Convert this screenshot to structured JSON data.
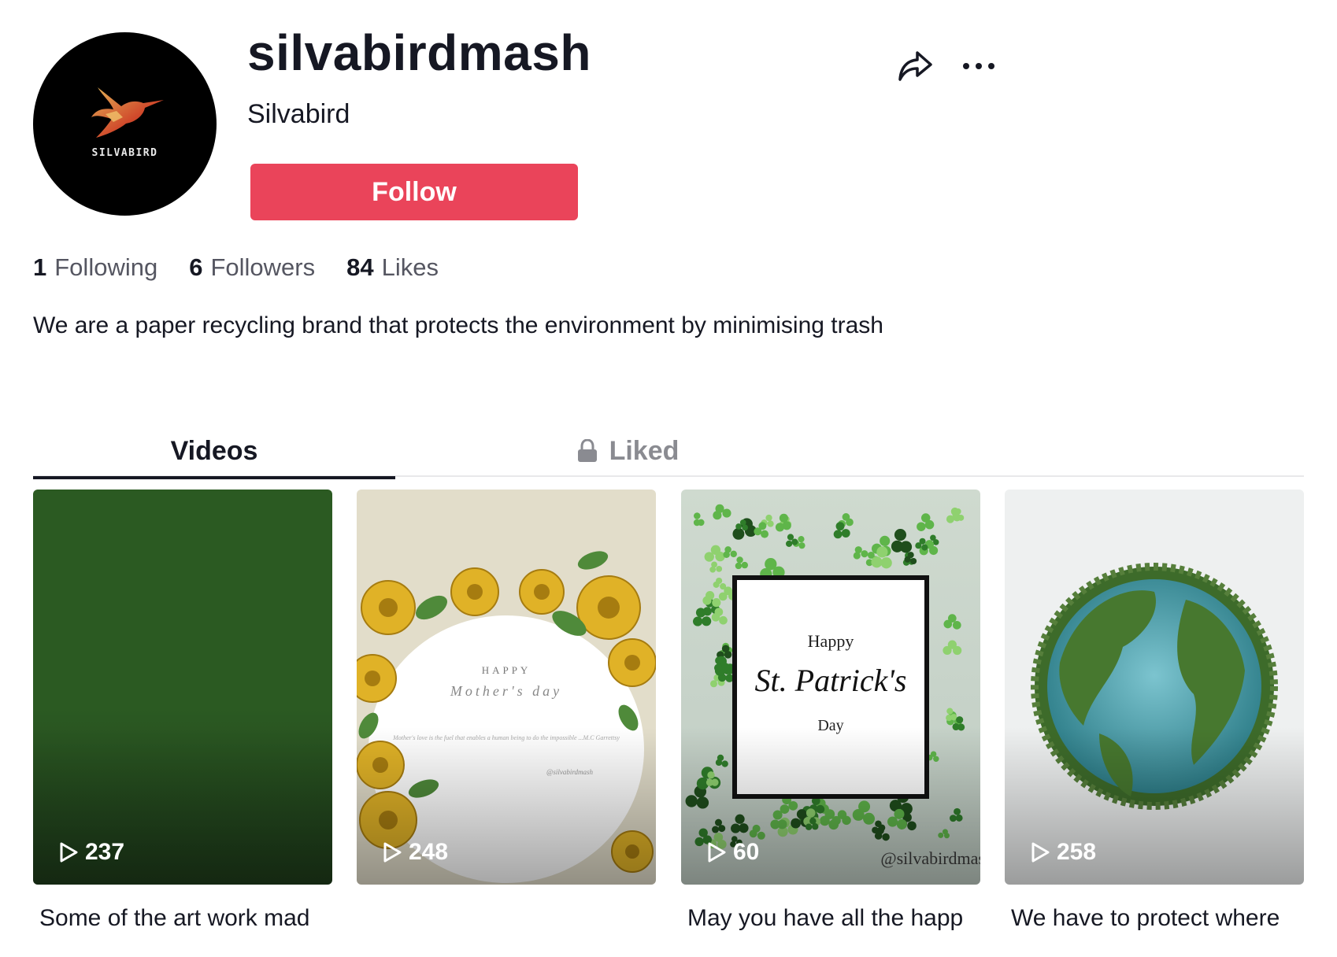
{
  "profile": {
    "username": "silvabirdmash",
    "nickname": "Silvabird",
    "avatar_brand": "SILVABIRD",
    "follow_label": "Follow",
    "share_icon": "share-arrow-icon",
    "more_icon": "ellipsis-icon"
  },
  "stats": [
    {
      "count": "1",
      "label": "Following"
    },
    {
      "count": "6",
      "label": "Followers"
    },
    {
      "count": "84",
      "label": "Likes"
    }
  ],
  "bio": "We are a paper recycling brand that protects the environment by minimising trash",
  "tabs": {
    "videos": "Videos",
    "liked": "Liked",
    "liked_icon": "lock-icon"
  },
  "videos": [
    {
      "plays": "237",
      "caption": "Some of the art work mad"
    },
    {
      "plays": "248",
      "caption": "",
      "card": {
        "happy": "HAPPY",
        "title": "Mother's day",
        "quote": "Mother's love is the fuel that enables a human being to do the impossible ...M.C Garrettsy",
        "handle": "@silvabirdmash"
      }
    },
    {
      "plays": "60",
      "caption": "May you have all the happ",
      "card": {
        "line1": "Happy",
        "line2": "St. Patrick's",
        "line3": "Day",
        "handle": "@silvabirdmas"
      }
    },
    {
      "plays": "258",
      "caption": "We have to protect where"
    }
  ],
  "colors": {
    "follow": "#ea445a",
    "text": "#161823",
    "muted": "#555661"
  }
}
